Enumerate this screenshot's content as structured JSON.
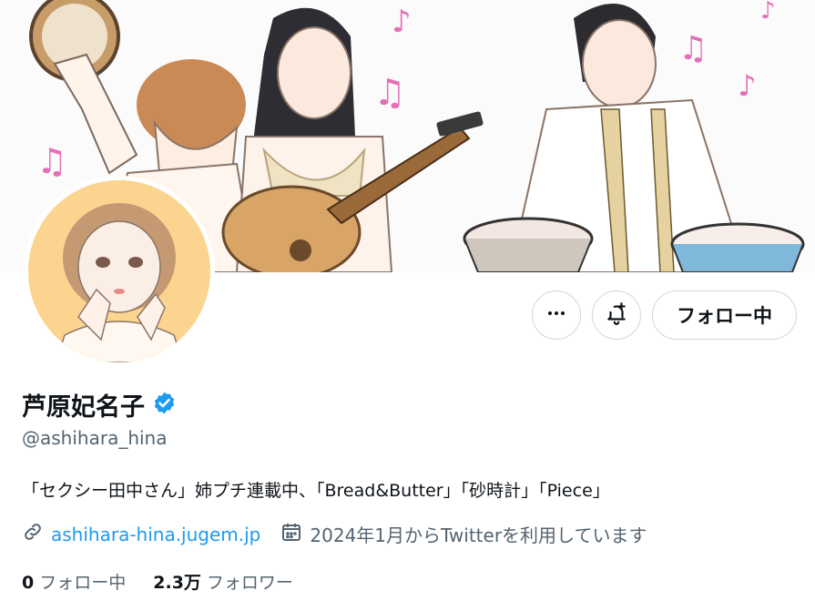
{
  "profile": {
    "display_name": "芦原妃名子",
    "handle": "@ashihara_hina",
    "bio": "「セクシー田中さん」姉プチ連載中、「Bread&Butter」「砂時計」「Piece」",
    "website": "ashihara-hina.jugem.jp",
    "joined": "2024年1月からTwitterを利用しています"
  },
  "actions": {
    "follow_label": "フォロー中"
  },
  "stats": {
    "following_count": "0",
    "following_label": "フォロー中",
    "followers_count": "2.3万",
    "followers_label": "フォロワー"
  },
  "icons": [
    "more-icon",
    "notification-bell-icon",
    "verified-badge-icon",
    "link-icon",
    "calendar-icon"
  ],
  "colors": {
    "accent": "#1d9bf0",
    "text": "#0f1419",
    "secondary": "#536471",
    "border": "#cfd9de"
  }
}
